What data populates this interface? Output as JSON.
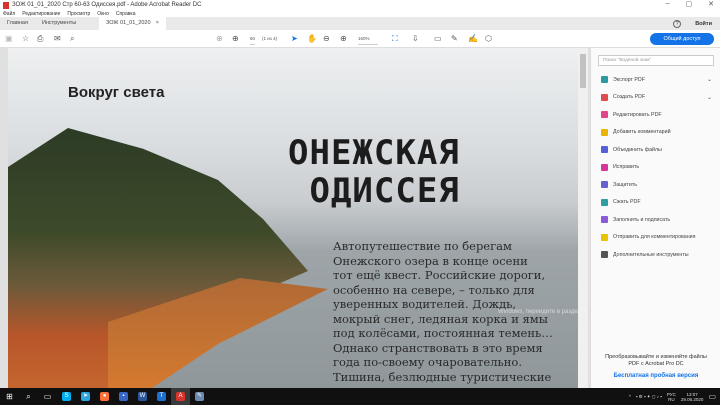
{
  "window": {
    "title": "ЗОЖ 01_01_2020 Стр 60-63 Одиссея.pdf - Adobe Acrobat Reader DC",
    "min": "–",
    "max": "▢",
    "close": "✕"
  },
  "menu": [
    "Файл",
    "Редактирование",
    "Просмотр",
    "Окно",
    "Справка"
  ],
  "tabs": {
    "home": "Главная",
    "tools": "Инструменты",
    "doc": "ЗОЖ 01_01_2020 ...",
    "doc_close": "×",
    "help": "?",
    "signin": "Войти"
  },
  "toolbar": {
    "page_num": "60",
    "page_of": "(1 из 4)",
    "zoom": "160%",
    "share": "Общий доступ"
  },
  "document": {
    "kicker": "Вокруг света",
    "headline": "ОНЕЖСКАЯ\nОДИССЕЯ",
    "body": "Автопутешествие по берегам\nОнежского озера в конце осени\nтот ещё квест. Российские дороги,\nособенно на севере, – только для\nуверенных водителей. Дождь,\nмокрый снег, ледяная корка и ямы\nпод колёсами, постоянная темень…\nОднако странствовать в это время\nгода по-своему очаровательно.\nТишина, безлюдные туристические\nместа, завораживающие"
  },
  "watermark": "Windows, перейдите в раздел \"Параметры\".",
  "panel": {
    "search_placeholder": "Поиск \"Водяной знак\"",
    "items": [
      {
        "label": "Экспорт PDF",
        "color": "#2b9aa0",
        "expand": "⌄"
      },
      {
        "label": "Создать PDF",
        "color": "#e04c4c",
        "expand": "⌄"
      },
      {
        "label": "Редактировать PDF",
        "color": "#e0468a"
      },
      {
        "label": "Добавить комментарий",
        "color": "#e8b400"
      },
      {
        "label": "Объединить файлы",
        "color": "#5660d8"
      },
      {
        "label": "Исправить",
        "color": "#d6369b"
      },
      {
        "label": "Защитить",
        "color": "#6a5fd1"
      },
      {
        "label": "Сжать PDF",
        "color": "#2e9ea3"
      },
      {
        "label": "Заполнить и подписать",
        "color": "#8a5bd6"
      },
      {
        "label": "Отправить для комментирования",
        "color": "#e8c300"
      },
      {
        "label": "Дополнительные инструменты",
        "color": "#555555"
      }
    ],
    "promo": "Преобразовывайте и изменяйте файлы PDF с Acrobat Pro DC",
    "promo_link": "Бесплатная пробная версия"
  },
  "taskbar": {
    "lang1": "РУС",
    "lang2": "RU",
    "time": "13:07",
    "date": "29.06.2020",
    "apps": [
      {
        "name": "skype",
        "color": "#00aff0",
        "g": "S"
      },
      {
        "name": "telegram",
        "color": "#2ca5e0",
        "g": "➤"
      },
      {
        "name": "firefox",
        "color": "#ff7139",
        "g": "●"
      },
      {
        "name": "save",
        "color": "#3a66c8",
        "g": "▪"
      },
      {
        "name": "word",
        "color": "#2b579a",
        "g": "W"
      },
      {
        "name": "app",
        "color": "#1e6fd0",
        "g": "T"
      },
      {
        "name": "acrobat",
        "color": "#d9342b",
        "g": "A"
      },
      {
        "name": "paint",
        "color": "#6c8ab0",
        "g": "✎"
      }
    ]
  }
}
